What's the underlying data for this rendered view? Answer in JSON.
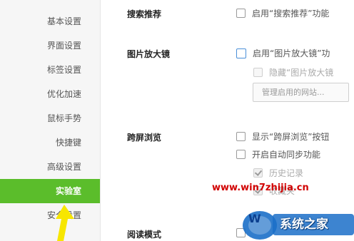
{
  "sidebar": {
    "items": [
      {
        "label": "基本设置"
      },
      {
        "label": "界面设置"
      },
      {
        "label": "标签设置"
      },
      {
        "label": "优化加速"
      },
      {
        "label": "鼠标手势"
      },
      {
        "label": "快捷键"
      },
      {
        "label": "高级设置"
      },
      {
        "label": "实验室"
      },
      {
        "label": "安全设置"
      }
    ],
    "active_color": "#5bbd2b"
  },
  "sections": {
    "search_recommend": {
      "title": "搜索推荐",
      "option": "启用“搜索推荐”功能"
    },
    "image_zoom": {
      "title": "图片放大镜",
      "option": "启用“图片放大镜”功",
      "hide_option": "隐藏“图片放大镜",
      "manage_button": "管理启用的网站..."
    },
    "cross_screen": {
      "title": "跨屏浏览",
      "show_option": "显示“跨屏浏览”按钮",
      "auto_sync": "开启自动同步功能",
      "history": "历史记录",
      "favorites": "收藏夹"
    },
    "reading_mode": {
      "title": "阅读模式"
    }
  },
  "watermark": {
    "url": "www.win7zhijia.cn",
    "logo_text": "系统之家"
  }
}
